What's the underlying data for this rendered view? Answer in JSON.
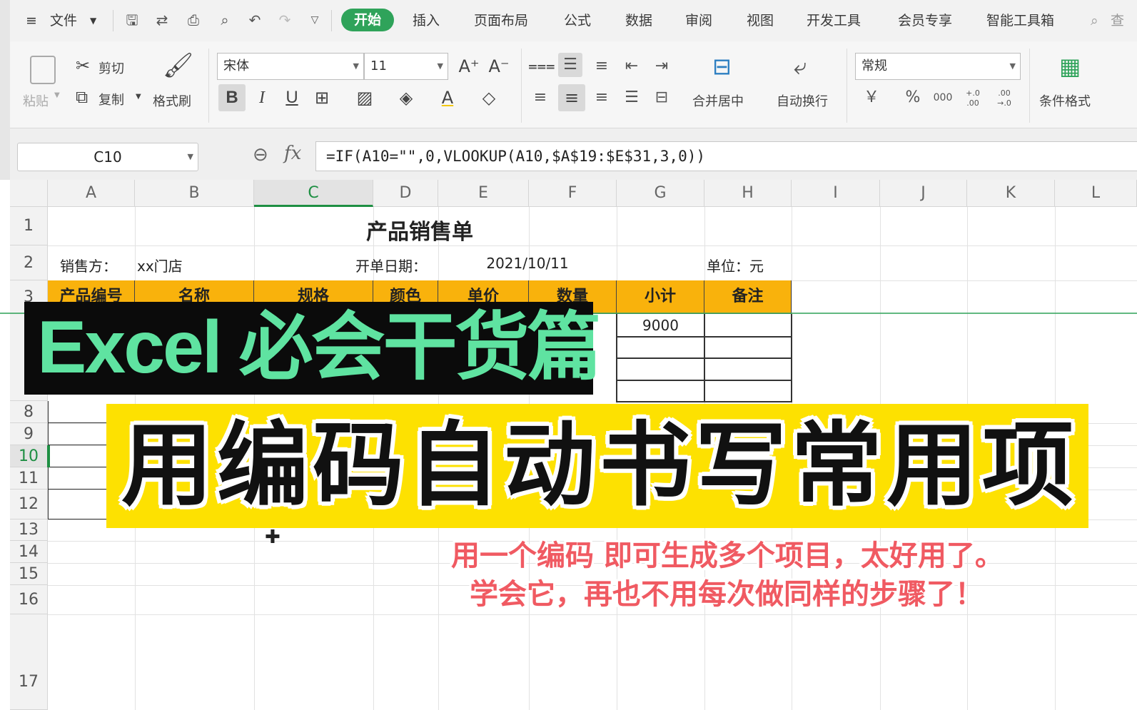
{
  "menubar": {
    "menu_icon": "≡",
    "file_label": "文件",
    "tabs": [
      "开始",
      "插入",
      "页面布局",
      "公式",
      "数据",
      "审阅",
      "视图",
      "开发工具",
      "会员专享",
      "智能工具箱"
    ],
    "search_hint": "查"
  },
  "ribbon": {
    "paste": "粘贴",
    "cut": "剪切",
    "copy": "复制",
    "format_painter": "格式刷",
    "font_name": "宋体",
    "font_size": "11",
    "bold": "B",
    "italic": "I",
    "underline": "U",
    "merge_center": "合并居中",
    "wrap_text": "自动换行",
    "number_format": "常规",
    "currency": "￥",
    "percent": "%",
    "thousands": "000",
    "inc_decimal": "+.0 .00",
    "dec_decimal": ".00 →.0",
    "conditional_format": "条件格式"
  },
  "formula_bar": {
    "name_box": "C10",
    "fx": "fx",
    "formula": "=IF(A10=\"\",0,VLOOKUP(A10,$A$19:$E$31,3,0))"
  },
  "sheet": {
    "columns": [
      "A",
      "B",
      "C",
      "D",
      "E",
      "F",
      "G",
      "H",
      "I",
      "J",
      "K",
      "L"
    ],
    "rows": [
      "1",
      "2",
      "3",
      "8",
      "9",
      "10",
      "11",
      "12",
      "13",
      "14",
      "15",
      "16",
      "17"
    ],
    "title": "产品销售单",
    "seller_label": "销售方：",
    "seller_value": "xx门店",
    "date_label": "开单日期：",
    "date_value": "2021/10/11",
    "unit_label": "单位：元",
    "headers": [
      "产品编号",
      "名称",
      "规格",
      "颜色",
      "单价",
      "数量",
      "小计",
      "备注"
    ],
    "subtotal_value": "9000"
  },
  "overlay": {
    "banner_title": "Excel 必会干货篇",
    "main_title": "用编码自动书写常用项",
    "caption_line1": "用一个编码 即可生成多个项目，太好用了。",
    "caption_line2": "学会它，再也不用每次做同样的步骤了！"
  },
  "colors": {
    "accent_green": "#2fa35a",
    "header_orange": "#f9b20c",
    "banner_green_text": "#5fe3a1",
    "banner_yellow": "#fde101",
    "caption_red": "#f05a62"
  }
}
